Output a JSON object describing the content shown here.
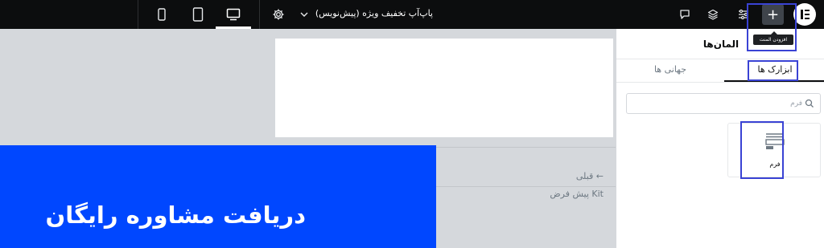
{
  "topbar": {
    "document_title": "پاپ‌آپ تخفیف ویژه (پیش‌نویس)",
    "add_tooltip": "افزودن المنت",
    "icons": [
      "mobile-icon",
      "tablet-icon",
      "desktop-icon",
      "gear-icon",
      "chevron-down-icon",
      "comment-icon",
      "layers-icon",
      "sliders-icon",
      "plus-icon",
      "elementor-logo"
    ]
  },
  "canvas": {
    "prev_link": "← قبلی",
    "kit_label": "Kit پیش فرض",
    "hero_heading": "دریافت مشاوره رایگان",
    "hero_color": "#0047ff"
  },
  "panel": {
    "title": "المان‌ها",
    "tabs": [
      {
        "label": "ابزارک ها",
        "active": true
      },
      {
        "label": "جهانی ها",
        "active": false
      }
    ],
    "search": {
      "placeholder": "فرم",
      "value": ""
    },
    "widgets": [
      {
        "label": "فرم",
        "icon": "form-icon"
      }
    ]
  },
  "highlight_color": "#3a43d4"
}
